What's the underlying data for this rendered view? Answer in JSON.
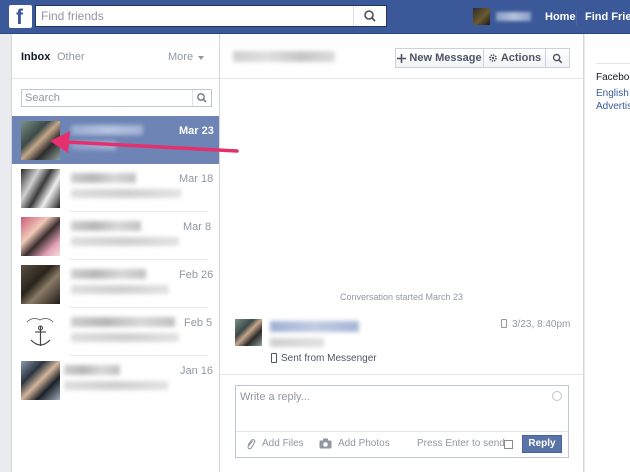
{
  "topbar": {
    "logo": "f",
    "search_placeholder": "Find friends",
    "nav_home": "Home",
    "nav_find": "Find Friends"
  },
  "inbox": {
    "tab_inbox": "Inbox",
    "tab_other": "Other",
    "more_label": "More",
    "search_placeholder": "Search",
    "conversations": [
      {
        "date": "Mar 23"
      },
      {
        "date": "Mar 18"
      },
      {
        "date": "Mar 8"
      },
      {
        "date": "Feb 26"
      },
      {
        "date": "Feb 5"
      },
      {
        "date": "Jan 16"
      }
    ]
  },
  "conversation": {
    "new_message_label": "New Message",
    "actions_label": "Actions",
    "started_text": "Conversation started March 23",
    "message_time": "3/23, 8:40pm",
    "sent_from": "Sent from Messenger",
    "reply_placeholder": "Write a reply...",
    "add_files_label": "Add Files",
    "add_photos_label": "Add Photos",
    "press_enter_label": "Press Enter to send",
    "reply_label": "Reply"
  },
  "right_rail": {
    "facebook_label": "Facebook",
    "english_label": "English",
    "advertising_label": "Advertising"
  },
  "colors": {
    "brand_blue": "#3b5998",
    "selected_row": "#6d84b4",
    "arrow": "#e5306e",
    "link": "#3b5998"
  }
}
